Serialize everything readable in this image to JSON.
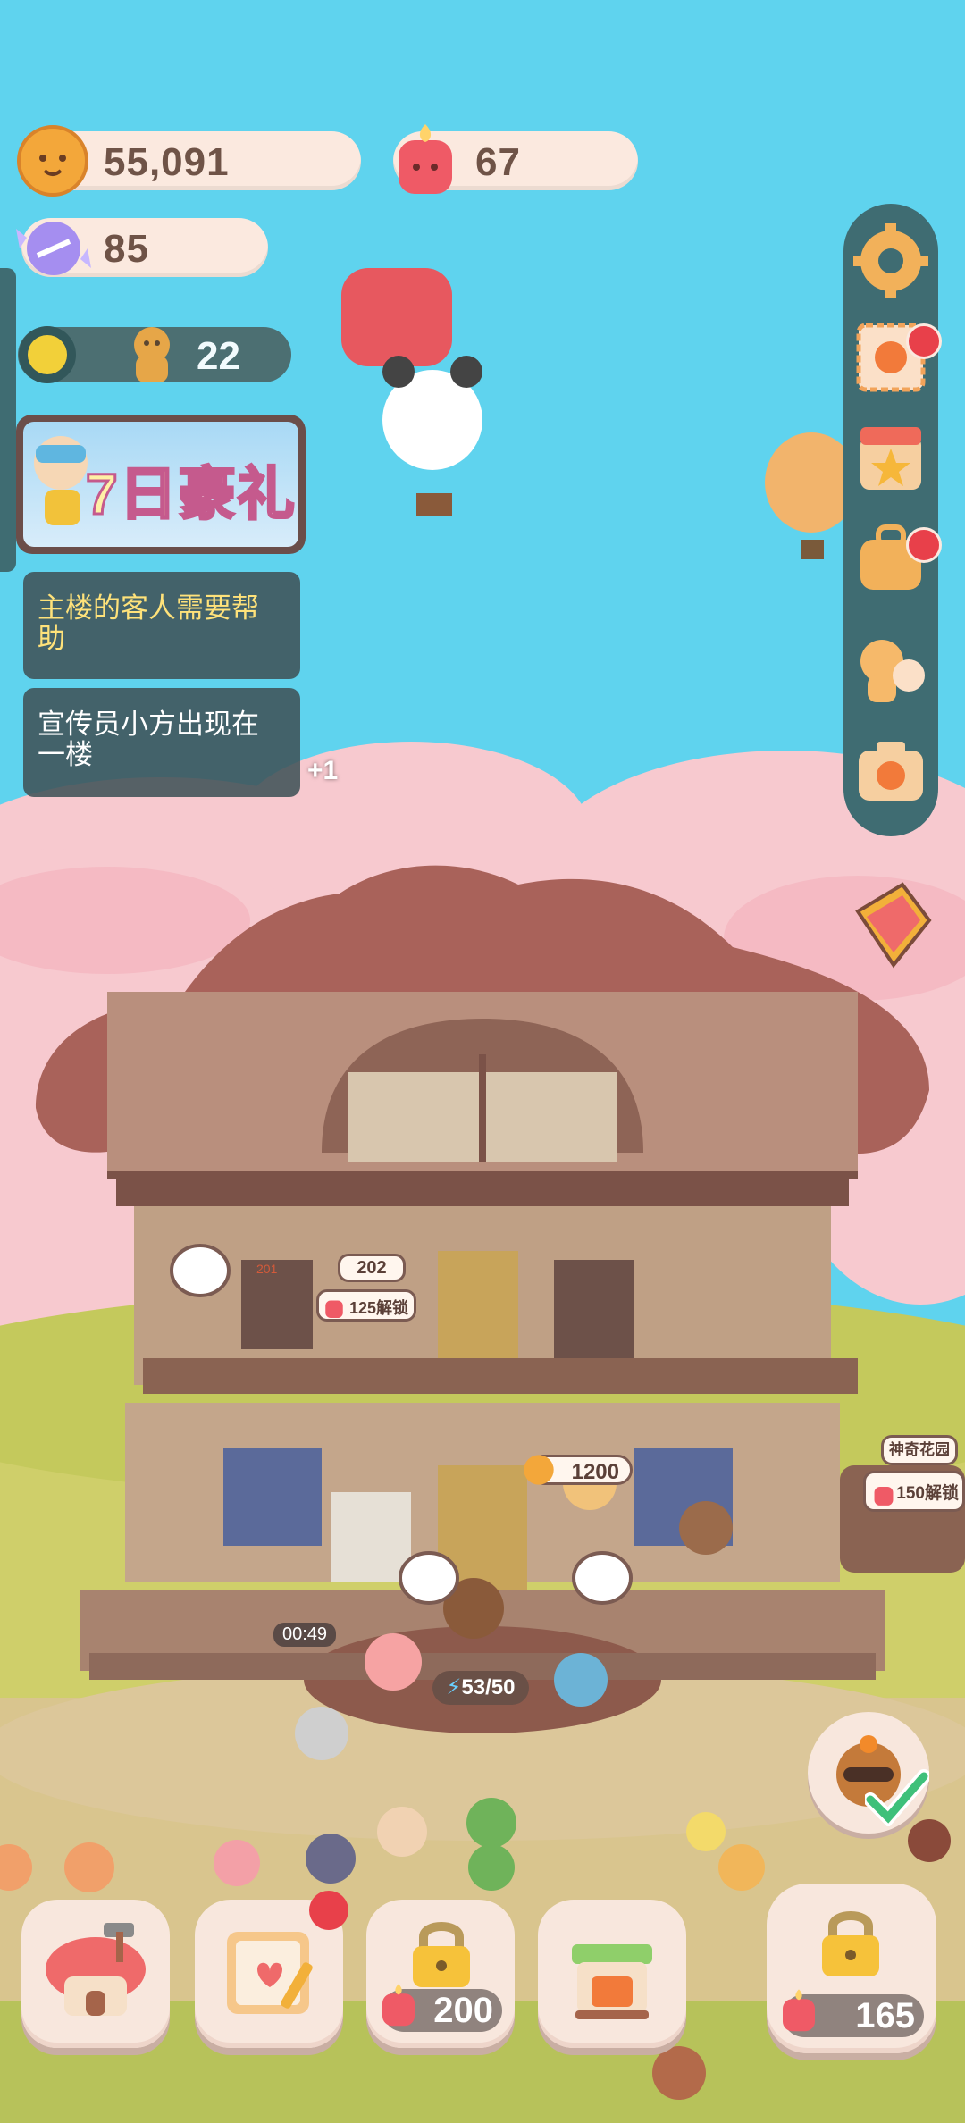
{
  "resources": {
    "cookies": "55,091",
    "candles": "67",
    "candy": "85",
    "tokens": "22"
  },
  "promo": {
    "prefix": "7日",
    "text": "豪礼"
  },
  "notices": [
    {
      "text": "主楼的客人需要帮助"
    },
    {
      "text": "宣传员小方出现在一楼"
    }
  ],
  "notice_more": "+1",
  "building": {
    "room_number": "202",
    "room_small": "201",
    "unlock_room": "125解锁",
    "coin_reward": "1200",
    "timer": "00:49",
    "energy": "53/50",
    "garden_name": "神奇花园",
    "garden_unlock": "150解锁"
  },
  "bottom_bar": {
    "locked_cost_1": "200",
    "locked_cost_2": "165"
  },
  "right_menu": [
    "gear-icon",
    "stamp-icon",
    "store-icon",
    "bag-icon",
    "characters-icon",
    "camera-icon"
  ],
  "colors": {
    "sky": "#5fd3ee",
    "panel": "#3f6c72",
    "notice": "#405258",
    "highlight": "#ffe27a"
  }
}
